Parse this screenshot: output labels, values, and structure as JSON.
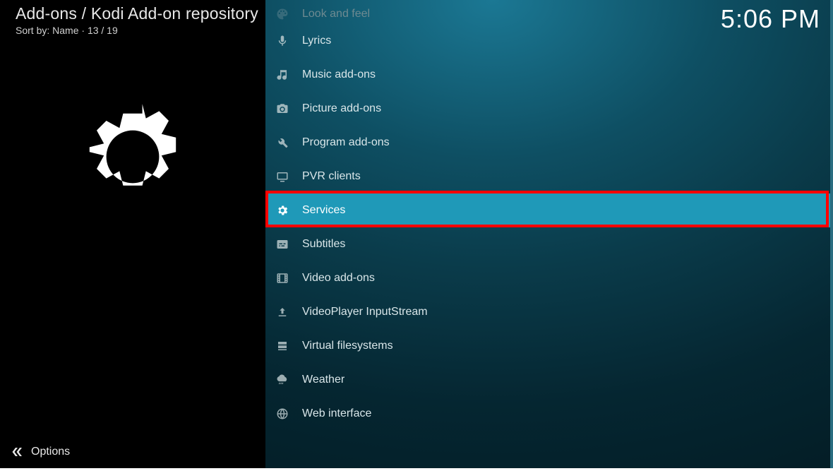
{
  "header": {
    "breadcrumb": "Add-ons / Kodi Add-on repository",
    "sort_label": "Sort by: Name",
    "counter": "13 / 19",
    "clock": "5:06 PM"
  },
  "footer": {
    "options_label": "Options"
  },
  "list": {
    "selected_index": 6,
    "highlighted_index": 6,
    "items": [
      {
        "icon": "palette-icon",
        "label": "Look and feel"
      },
      {
        "icon": "microphone-icon",
        "label": "Lyrics"
      },
      {
        "icon": "music-note-icon",
        "label": "Music add-ons"
      },
      {
        "icon": "camera-icon",
        "label": "Picture add-ons"
      },
      {
        "icon": "tools-icon",
        "label": "Program add-ons"
      },
      {
        "icon": "tv-icon",
        "label": "PVR clients"
      },
      {
        "icon": "gear-icon",
        "label": "Services"
      },
      {
        "icon": "subtitles-icon",
        "label": "Subtitles"
      },
      {
        "icon": "film-icon",
        "label": "Video add-ons"
      },
      {
        "icon": "upload-icon",
        "label": "VideoPlayer InputStream"
      },
      {
        "icon": "disks-icon",
        "label": "Virtual filesystems"
      },
      {
        "icon": "weather-icon",
        "label": "Weather"
      },
      {
        "icon": "globe-icon",
        "label": "Web interface"
      }
    ]
  }
}
